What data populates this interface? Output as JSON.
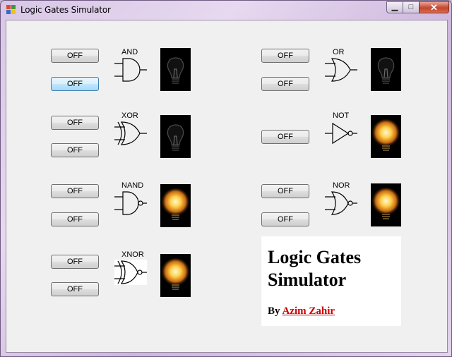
{
  "window": {
    "title": "Logic Gates Simulator",
    "controls": {
      "minimize": "▁",
      "maximize": "□",
      "close": "✕"
    }
  },
  "gates": [
    {
      "id": "and",
      "label": "AND",
      "inputs": [
        "OFF",
        "OFF"
      ],
      "output_on": false
    },
    {
      "id": "or",
      "label": "OR",
      "inputs": [
        "OFF",
        "OFF"
      ],
      "output_on": false
    },
    {
      "id": "xor",
      "label": "XOR",
      "inputs": [
        "OFF",
        "OFF"
      ],
      "output_on": false
    },
    {
      "id": "not",
      "label": "NOT",
      "inputs": [
        "OFF"
      ],
      "output_on": true
    },
    {
      "id": "nand",
      "label": "NAND",
      "inputs": [
        "OFF",
        "OFF"
      ],
      "output_on": true
    },
    {
      "id": "nor",
      "label": "NOR",
      "inputs": [
        "OFF",
        "OFF"
      ],
      "output_on": true
    },
    {
      "id": "xnor",
      "label": "XNOR",
      "inputs": [
        "OFF",
        "OFF"
      ],
      "output_on": true
    }
  ],
  "credit": {
    "heading": "Logic Gates Simulator",
    "by_label": "By",
    "author": "Azim Zahir"
  },
  "colors": {
    "author_link": "#cc0000",
    "bulb_on_glow": "#ffd04a",
    "bulb_off": "#3a3a3a"
  }
}
